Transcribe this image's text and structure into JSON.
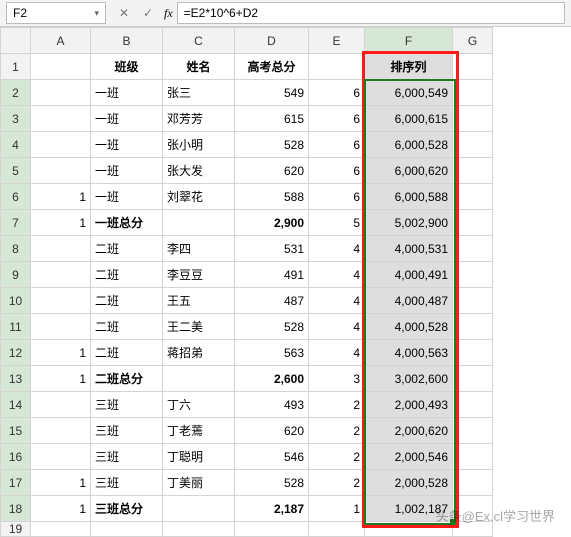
{
  "nameBox": "F2",
  "formulaBar": "=E2*10^6+D2",
  "icons": {
    "cancel": "✕",
    "accept": "✓",
    "fx": "fx",
    "drop": "▾"
  },
  "columns": [
    "A",
    "B",
    "C",
    "D",
    "E",
    "F",
    "G"
  ],
  "headerRow": {
    "A": "",
    "B": "班级",
    "C": "姓名",
    "D": "高考总分",
    "E": "",
    "F": "排序列",
    "G": ""
  },
  "rows": [
    {
      "n": 2,
      "A": "",
      "B": "一班",
      "C": "张三",
      "D": "549",
      "E": "6",
      "F": "6,000,549"
    },
    {
      "n": 3,
      "A": "",
      "B": "一班",
      "C": "邓芳芳",
      "D": "615",
      "E": "6",
      "F": "6,000,615"
    },
    {
      "n": 4,
      "A": "",
      "B": "一班",
      "C": "张小明",
      "D": "528",
      "E": "6",
      "F": "6,000,528"
    },
    {
      "n": 5,
      "A": "",
      "B": "一班",
      "C": "张大发",
      "D": "620",
      "E": "6",
      "F": "6,000,620"
    },
    {
      "n": 6,
      "A": "1",
      "B": "一班",
      "C": "刘翠花",
      "D": "588",
      "E": "6",
      "F": "6,000,588"
    },
    {
      "n": 7,
      "A": "1",
      "B": "一班总分",
      "C": "",
      "D": "2,900",
      "E": "5",
      "F": "5,002,900",
      "total": true
    },
    {
      "n": 8,
      "A": "",
      "B": "二班",
      "C": "李四",
      "D": "531",
      "E": "4",
      "F": "4,000,531"
    },
    {
      "n": 9,
      "A": "",
      "B": "二班",
      "C": "李豆豆",
      "D": "491",
      "E": "4",
      "F": "4,000,491"
    },
    {
      "n": 10,
      "A": "",
      "B": "二班",
      "C": "王五",
      "D": "487",
      "E": "4",
      "F": "4,000,487"
    },
    {
      "n": 11,
      "A": "",
      "B": "二班",
      "C": "王二美",
      "D": "528",
      "E": "4",
      "F": "4,000,528"
    },
    {
      "n": 12,
      "A": "1",
      "B": "二班",
      "C": "蒋招弟",
      "D": "563",
      "E": "4",
      "F": "4,000,563"
    },
    {
      "n": 13,
      "A": "1",
      "B": "二班总分",
      "C": "",
      "D": "2,600",
      "E": "3",
      "F": "3,002,600",
      "total": true
    },
    {
      "n": 14,
      "A": "",
      "B": "三班",
      "C": "丁六",
      "D": "493",
      "E": "2",
      "F": "2,000,493"
    },
    {
      "n": 15,
      "A": "",
      "B": "三班",
      "C": "丁老蔫",
      "D": "620",
      "E": "2",
      "F": "2,000,620"
    },
    {
      "n": 16,
      "A": "",
      "B": "三班",
      "C": "丁聪明",
      "D": "546",
      "E": "2",
      "F": "2,000,546"
    },
    {
      "n": 17,
      "A": "1",
      "B": "三班",
      "C": "丁美丽",
      "D": "528",
      "E": "2",
      "F": "2,000,528"
    },
    {
      "n": 18,
      "A": "1",
      "B": "三班总分",
      "C": "",
      "D": "2,187",
      "E": "1",
      "F": "1,002,187",
      "total": true
    }
  ],
  "partialRow": 19,
  "watermark": "头条@Ex.cl学习世界"
}
